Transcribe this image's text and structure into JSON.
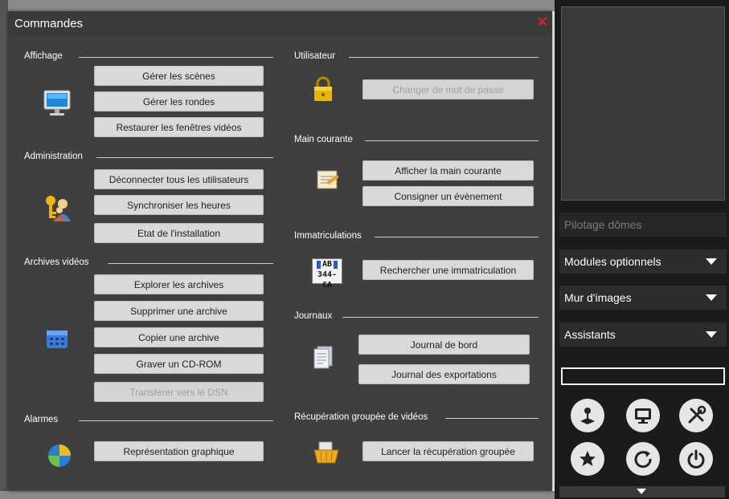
{
  "dialog": {
    "title": "Commandes",
    "close_glyph": "✕"
  },
  "left": {
    "affichage": {
      "title": "Affichage",
      "buttons": [
        "Gérer les scènes",
        "Gérer les rondes",
        "Restaurer les fenêtres vidéos"
      ]
    },
    "administration": {
      "title": "Administration",
      "buttons": [
        "Déconnecter tous les utilisateurs",
        "Synchroniser les heures",
        "Etat de l'installation"
      ]
    },
    "archives": {
      "title": "Archives vidéos",
      "buttons": [
        "Explorer les archives",
        "Supprimer une archive",
        "Copier une archive",
        "Graver un CD-ROM",
        "Transférer vers le DSN"
      ]
    },
    "alarmes": {
      "title": "Alarmes",
      "buttons": [
        "Représentation graphique"
      ]
    }
  },
  "right": {
    "utilisateur": {
      "title": "Utilisateur",
      "buttons": [
        "Changer de mot de passe"
      ]
    },
    "main_courante": {
      "title": "Main courante",
      "buttons": [
        "Afficher la main courante",
        "Consigner un évènement"
      ]
    },
    "immatriculations": {
      "title": "Immatriculations",
      "buttons": [
        "Rechercher une immatriculation"
      ],
      "plate_top": "AB",
      "plate_bottom": "344-CA"
    },
    "journaux": {
      "title": "Journaux",
      "buttons": [
        "Journal de bord",
        "Journal des exportations"
      ]
    },
    "recuperation": {
      "title": "Récupération groupée de vidéos",
      "buttons": [
        "Lancer la récupération groupée"
      ]
    }
  },
  "panel": {
    "pilotage": "Pilotage dômes",
    "modules": "Modules optionnels",
    "mur": "Mur d'images",
    "assistants": "Assistants"
  },
  "colors": {
    "dialog_bg": "#3f3f3f",
    "button_bg": "#d9d9d9",
    "close": "#e02020",
    "panel_bg": "#1b1b1b"
  }
}
